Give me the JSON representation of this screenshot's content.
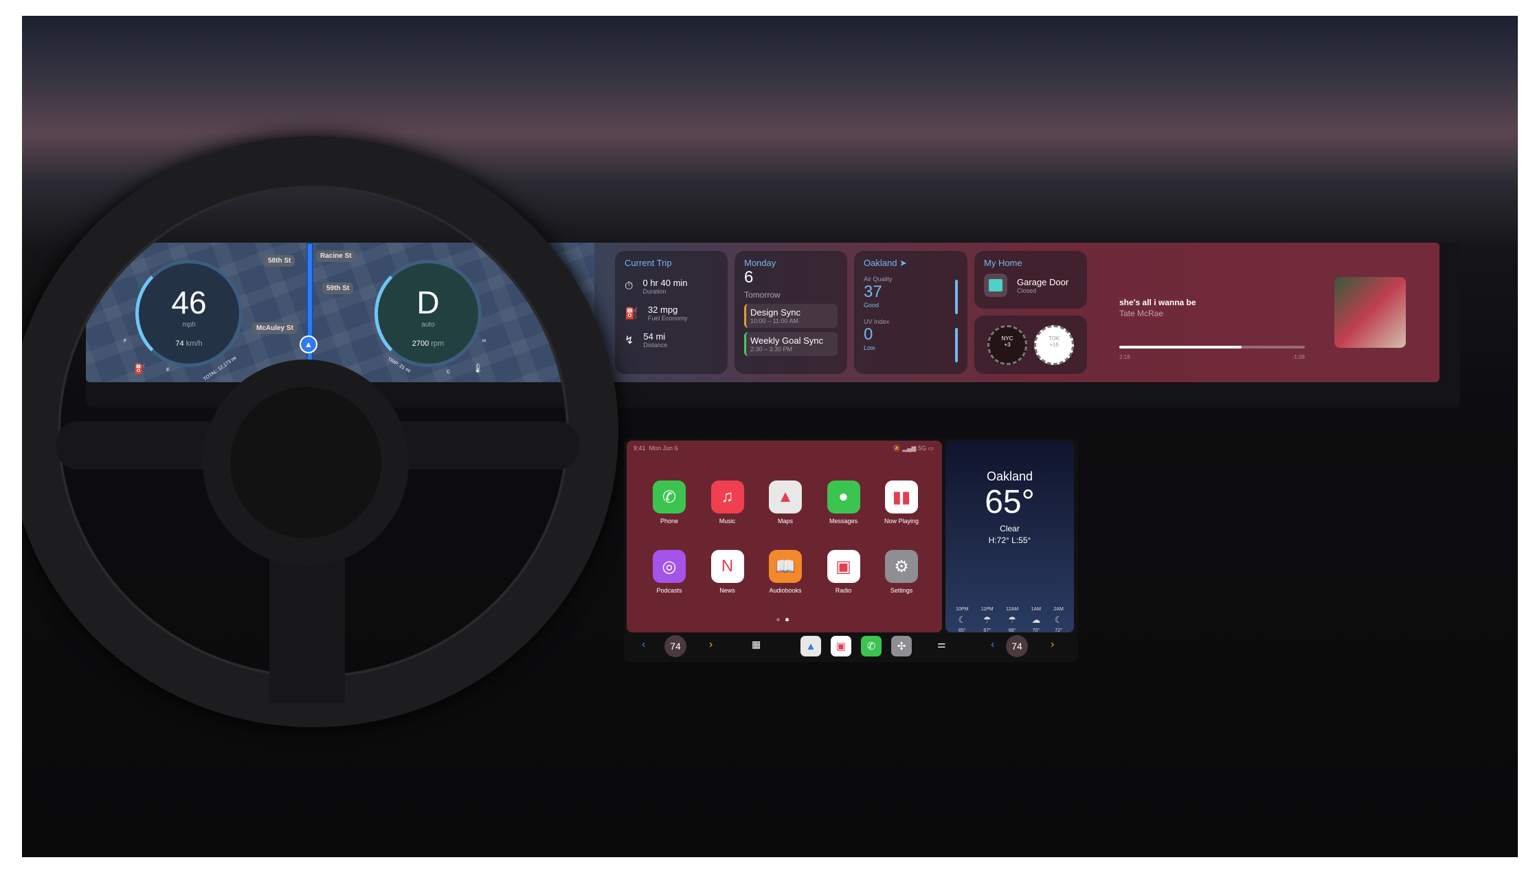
{
  "colors": {
    "accent": "#74b8f0",
    "carplay_bg": "#6b2531",
    "route": "#2f7bf2"
  },
  "cluster": {
    "streets": [
      "58th St",
      "Racine St",
      "59th St",
      "McAuley St"
    ],
    "speed": "46",
    "speed_unit": "mph",
    "speed_kmh": "74",
    "speed_kmh_unit": "km/h",
    "total": "TOTAL: 12,173 mi",
    "fuel_low": "E",
    "fuel_high": "F",
    "gear": "D",
    "gear_mode": "auto",
    "rpm": "2700",
    "rpm_unit": "rpm",
    "trip": "TRIP: 21 mi",
    "temp_low": "C",
    "temp_high": "H"
  },
  "widgets": {
    "trip": {
      "title": "Current Trip",
      "items": [
        {
          "icon": "stopwatch-icon",
          "value": "0 hr 40 min",
          "label": "Duration"
        },
        {
          "icon": "fuel-pump-icon",
          "value": "32 mpg",
          "label": "Fuel Economy"
        },
        {
          "icon": "route-icon",
          "value": "54 mi",
          "label": "Distance"
        }
      ]
    },
    "calendar": {
      "day": "Monday",
      "date": "6",
      "tomorrow": "Tomorrow",
      "events": [
        {
          "title": "Design Sync",
          "time": "10:00 – 11:00 AM",
          "color": "#e0a030"
        },
        {
          "title": "Weekly Goal Sync",
          "time": "2:30 – 3:30 PM",
          "color": "#4cc85a"
        }
      ]
    },
    "air": {
      "city": "Oakland",
      "aq_label": "Air Quality",
      "aq_value": "37",
      "aq_desc": "Good",
      "uv_label": "UV Index",
      "uv_value": "0",
      "uv_desc": "Low"
    },
    "home": {
      "title": "My Home",
      "device": "Garage Door",
      "state": "Closed"
    },
    "clocks": [
      {
        "city": "NYC",
        "offset": "+3"
      },
      {
        "city": "TOK",
        "offset": "+16"
      }
    ],
    "now_playing": {
      "title": "she's all i wanna be",
      "artist": "Tate McRae",
      "elapsed": "2:18",
      "remaining": "-1:08",
      "progress": 0.66
    }
  },
  "carplay": {
    "status": {
      "time": "9:41",
      "date": "Mon Jun 6",
      "network": "5G"
    },
    "apps": [
      {
        "label": "Phone",
        "icon": "phone-icon",
        "color": "#3cc451"
      },
      {
        "label": "Music",
        "icon": "music-note-icon",
        "color": "#f0404f"
      },
      {
        "label": "Maps",
        "icon": "maps-icon",
        "color": "#e8e8e8"
      },
      {
        "label": "Messages",
        "icon": "message-bubble-icon",
        "color": "#3cc451"
      },
      {
        "label": "Now Playing",
        "icon": "waveform-icon",
        "color": "#ffffff"
      },
      {
        "label": "Podcasts",
        "icon": "podcast-icon",
        "color": "#a454e8"
      },
      {
        "label": "News",
        "icon": "news-icon",
        "color": "#ffffff"
      },
      {
        "label": "Audiobooks",
        "icon": "book-icon",
        "color": "#f2892a"
      },
      {
        "label": "Radio",
        "icon": "radio-icon",
        "color": "#ffffff"
      },
      {
        "label": "Settings",
        "icon": "gear-icon",
        "color": "#8e8e93"
      }
    ],
    "page": 2,
    "pages": 2,
    "weather": {
      "city": "Oakland",
      "temp": "65°",
      "condition": "Clear",
      "hilo": "H:72°  L:55°",
      "hourly": [
        {
          "time": "10PM",
          "icon": "moon-icon",
          "temp": "65°"
        },
        {
          "time": "11PM",
          "icon": "cloud-rain-icon",
          "temp": "67°"
        },
        {
          "time": "12AM",
          "icon": "cloud-rain-icon",
          "temp": "68°"
        },
        {
          "time": "1AM",
          "icon": "cloud-moon-icon",
          "temp": "70°"
        },
        {
          "time": "2AM",
          "icon": "moon-icon",
          "temp": "72°"
        }
      ]
    },
    "dock": {
      "left_temp": "74",
      "right_temp": "74"
    }
  }
}
